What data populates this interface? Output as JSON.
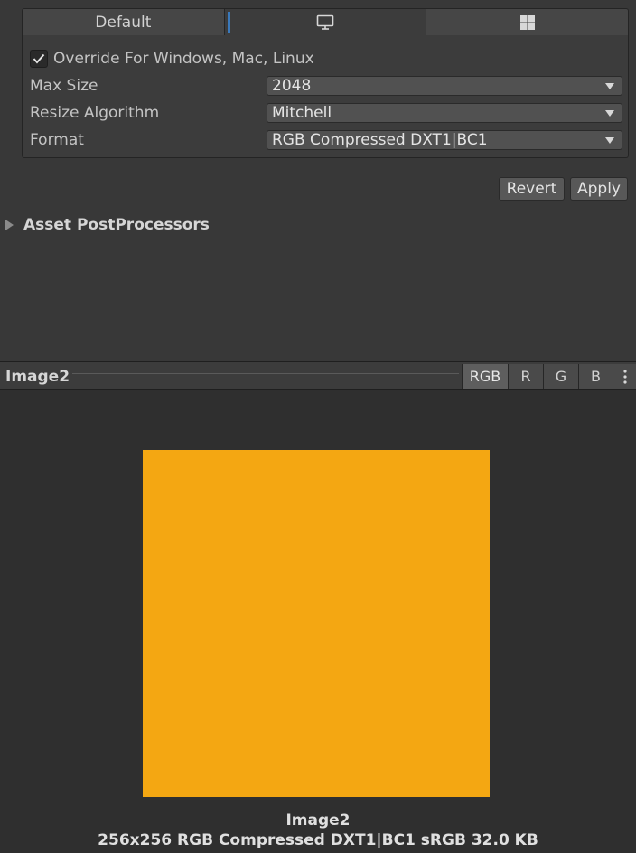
{
  "platform_tabs": {
    "default_label": "Default",
    "standalone_icon": "monitor-icon",
    "windows_store_icon": "windows-logo-icon"
  },
  "override": {
    "checked": true,
    "label": "Override For Windows, Mac, Linux"
  },
  "settings": {
    "max_size": {
      "label": "Max Size",
      "value": "2048"
    },
    "resize_algorithm": {
      "label": "Resize Algorithm",
      "value": "Mitchell"
    },
    "format": {
      "label": "Format",
      "value": "RGB Compressed DXT1|BC1"
    }
  },
  "actions": {
    "revert_label": "Revert",
    "apply_label": "Apply"
  },
  "asset_postprocessors": {
    "label": "Asset PostProcessors",
    "expanded": false
  },
  "preview": {
    "title": "Image2",
    "channels": [
      "RGB",
      "R",
      "G",
      "B"
    ],
    "selected_channel": "RGB",
    "menu_icon": "kebab-menu-icon",
    "texture_color": "#f4a712",
    "caption_name": "Image2",
    "caption_info": "256x256  RGB Compressed DXT1|BC1 sRGB   32.0 KB"
  },
  "colors": {
    "background": "#383838",
    "panel": "#3c3c3c",
    "accent": "#3a79bb",
    "preview_background": "#2f2f2f"
  }
}
